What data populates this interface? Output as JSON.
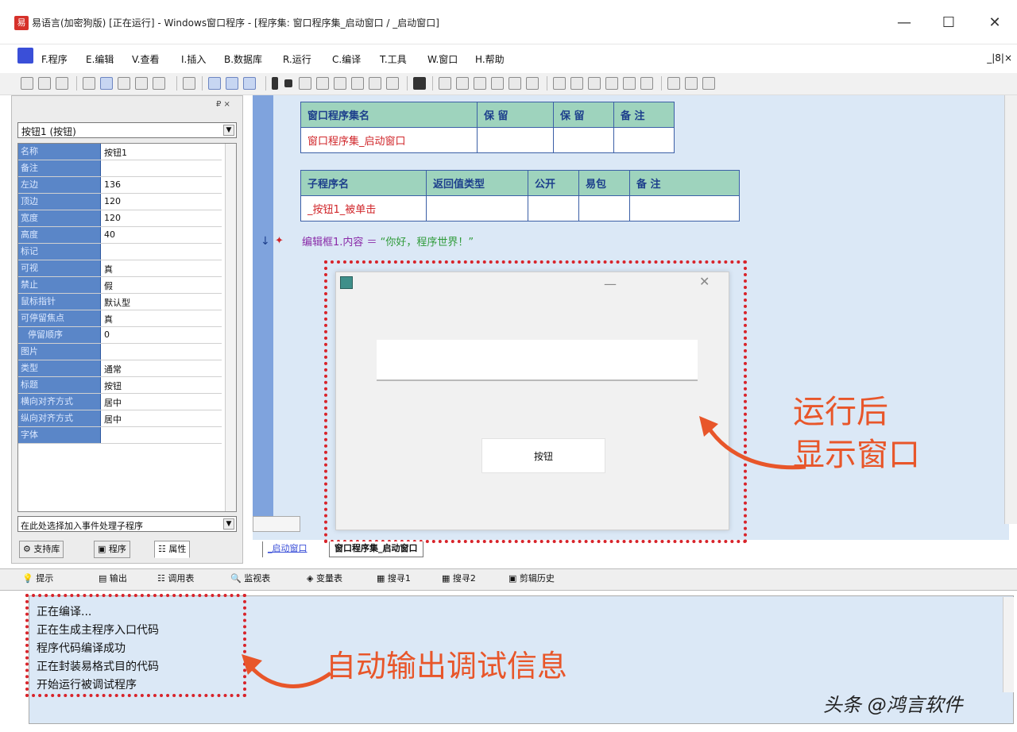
{
  "window": {
    "title": "易语言(加密狗版) [正在运行] - Windows窗口程序 - [程序集: 窗口程序集_启动窗口 / _启动窗口]",
    "app_icon_label": "易",
    "minimize": "—",
    "maximize": "☐",
    "close": "✕"
  },
  "menu": {
    "items": [
      "F.程序",
      "E.编辑",
      "V.查看",
      "I.插入",
      "B.数据库",
      "R.运行",
      "C.编译",
      "T.工具",
      "W.窗口",
      "H.帮助"
    ],
    "mdi_controls": "_|8|×"
  },
  "property_panel": {
    "pin": "₽ ×",
    "object_select": "按钮1 (按钮)",
    "properties": [
      {
        "name": "名称",
        "value": "按钮1"
      },
      {
        "name": "备注",
        "value": ""
      },
      {
        "name": "左边",
        "value": "136"
      },
      {
        "name": "顶边",
        "value": "120"
      },
      {
        "name": "宽度",
        "value": "120"
      },
      {
        "name": "高度",
        "value": "40"
      },
      {
        "name": "标记",
        "value": ""
      },
      {
        "name": "可视",
        "value": "真"
      },
      {
        "name": "禁止",
        "value": "假"
      },
      {
        "name": "鼠标指针",
        "value": "默认型"
      },
      {
        "name": "可停留焦点",
        "value": "真"
      },
      {
        "name": "停留顺序",
        "value": "0"
      },
      {
        "name": "图片",
        "value": ""
      },
      {
        "name": "类型",
        "value": "通常"
      },
      {
        "name": "标题",
        "value": "按钮"
      },
      {
        "name": "横向对齐方式",
        "value": "居中"
      },
      {
        "name": "纵向对齐方式",
        "value": "居中"
      },
      {
        "name": "字体",
        "value": ""
      }
    ],
    "event_select": "在此处选择加入事件处理子程序",
    "tabs": [
      "支持库",
      "程序",
      "属性"
    ]
  },
  "code": {
    "assembly_table": {
      "headers": [
        "窗口程序集名",
        "保 留",
        "保 留",
        "备 注"
      ],
      "row": [
        "窗口程序集_启动窗口",
        "",
        "",
        ""
      ]
    },
    "sub_table": {
      "headers": [
        "子程序名",
        "返回值类型",
        "公开",
        "易包",
        "备 注"
      ],
      "row": [
        "_按钮1_被单击",
        "",
        "",
        "",
        ""
      ]
    },
    "line_target": "编辑框1.内容",
    "line_op": " ＝ ",
    "line_value": "“你好，程序世界！”",
    "tabs": [
      "_启动窗口",
      "窗口程序集_启动窗口"
    ]
  },
  "run_window": {
    "button_label": "按钮"
  },
  "annotations": {
    "run_line1": "运行后",
    "run_line2": "显示窗口",
    "output": "自动输出调试信息",
    "watermark": "头条 @鸿言软件"
  },
  "output_panel": {
    "tabs": [
      "提示",
      "输出",
      "调用表",
      "监视表",
      "变量表",
      "搜寻1",
      "搜寻2",
      "剪辑历史"
    ],
    "lines": [
      "正在编译...",
      "正在生成主程序入口代码",
      "程序代码编译成功",
      "正在封装易格式目的代码",
      "开始运行被调试程序"
    ]
  },
  "colors": {
    "header_green": "#9ed3bd",
    "code_bg": "#dbe8f6",
    "annotation": "#e8562a",
    "dotted_border": "#d8232a"
  }
}
